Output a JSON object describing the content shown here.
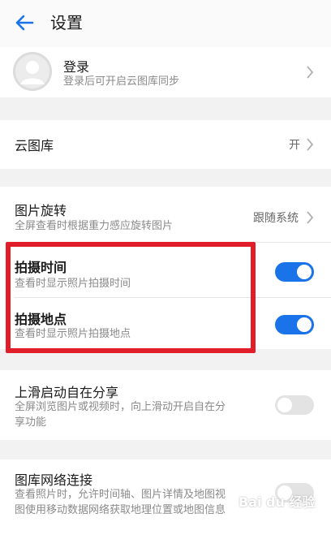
{
  "header": {
    "title": "设置",
    "back_icon": "arrow-left-icon",
    "accent": "#1a73e8"
  },
  "account": {
    "title": "登录",
    "subtitle": "登录后可开启云图库同步"
  },
  "cloud": {
    "title": "云图库",
    "value": "开"
  },
  "rotate": {
    "title": "图片旋转",
    "subtitle": "全屏查看时根据重力感应旋转图片",
    "value": "跟随系统"
  },
  "shoot_time": {
    "title": "拍摄时间",
    "subtitle": "查看时显示照片拍摄时间",
    "enabled": true
  },
  "shoot_place": {
    "title": "拍摄地点",
    "subtitle": "查看时显示照片拍摄地点",
    "enabled": true
  },
  "swipe_share": {
    "title": "上滑启动自在分享",
    "subtitle_line1": "全屏浏览图片或视频时，向上滑动开启自在分",
    "subtitle_line2": "享功能",
    "enabled": false
  },
  "network": {
    "title": "图库网络连接",
    "subtitle_line1": "查看照片时，允许时间轴、图片详情及地图视",
    "subtitle_line2": "图使用移动数据网络获取地理位置或地图信息",
    "enabled": false
  },
  "watermark": "Bai du 经验",
  "colors": {
    "highlight": "#e11d2a",
    "toggle_on": "#1a73e8",
    "toggle_off": "#e3e3e3"
  }
}
